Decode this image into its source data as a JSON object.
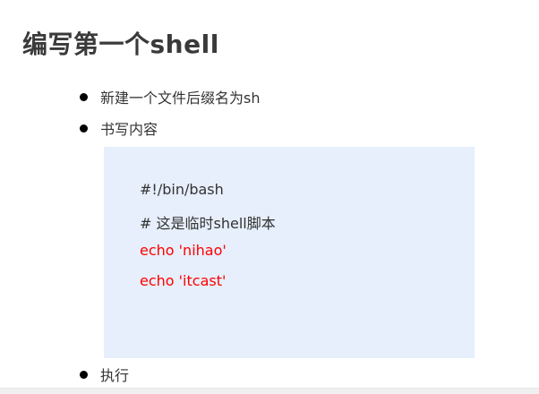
{
  "slide": {
    "title": "编写第一个shell",
    "bullets": [
      {
        "text": "新建一个文件后缀名为sh"
      },
      {
        "text": "书写内容"
      },
      {
        "text": "执行"
      }
    ],
    "code": {
      "lines": [
        {
          "text": "#!/bin/bash",
          "color": "#333333"
        },
        {
          "text": "# 这是临时shell脚本",
          "color": "#333333"
        },
        {
          "text": "echo 'nihao'",
          "color": "#ff0000"
        },
        {
          "text": "echo 'itcast'",
          "color": "#ff0000"
        }
      ],
      "background": "#e6effb"
    }
  },
  "colors": {
    "title": "#3a3a3a",
    "text": "#333333",
    "highlight": "#ff0000"
  }
}
